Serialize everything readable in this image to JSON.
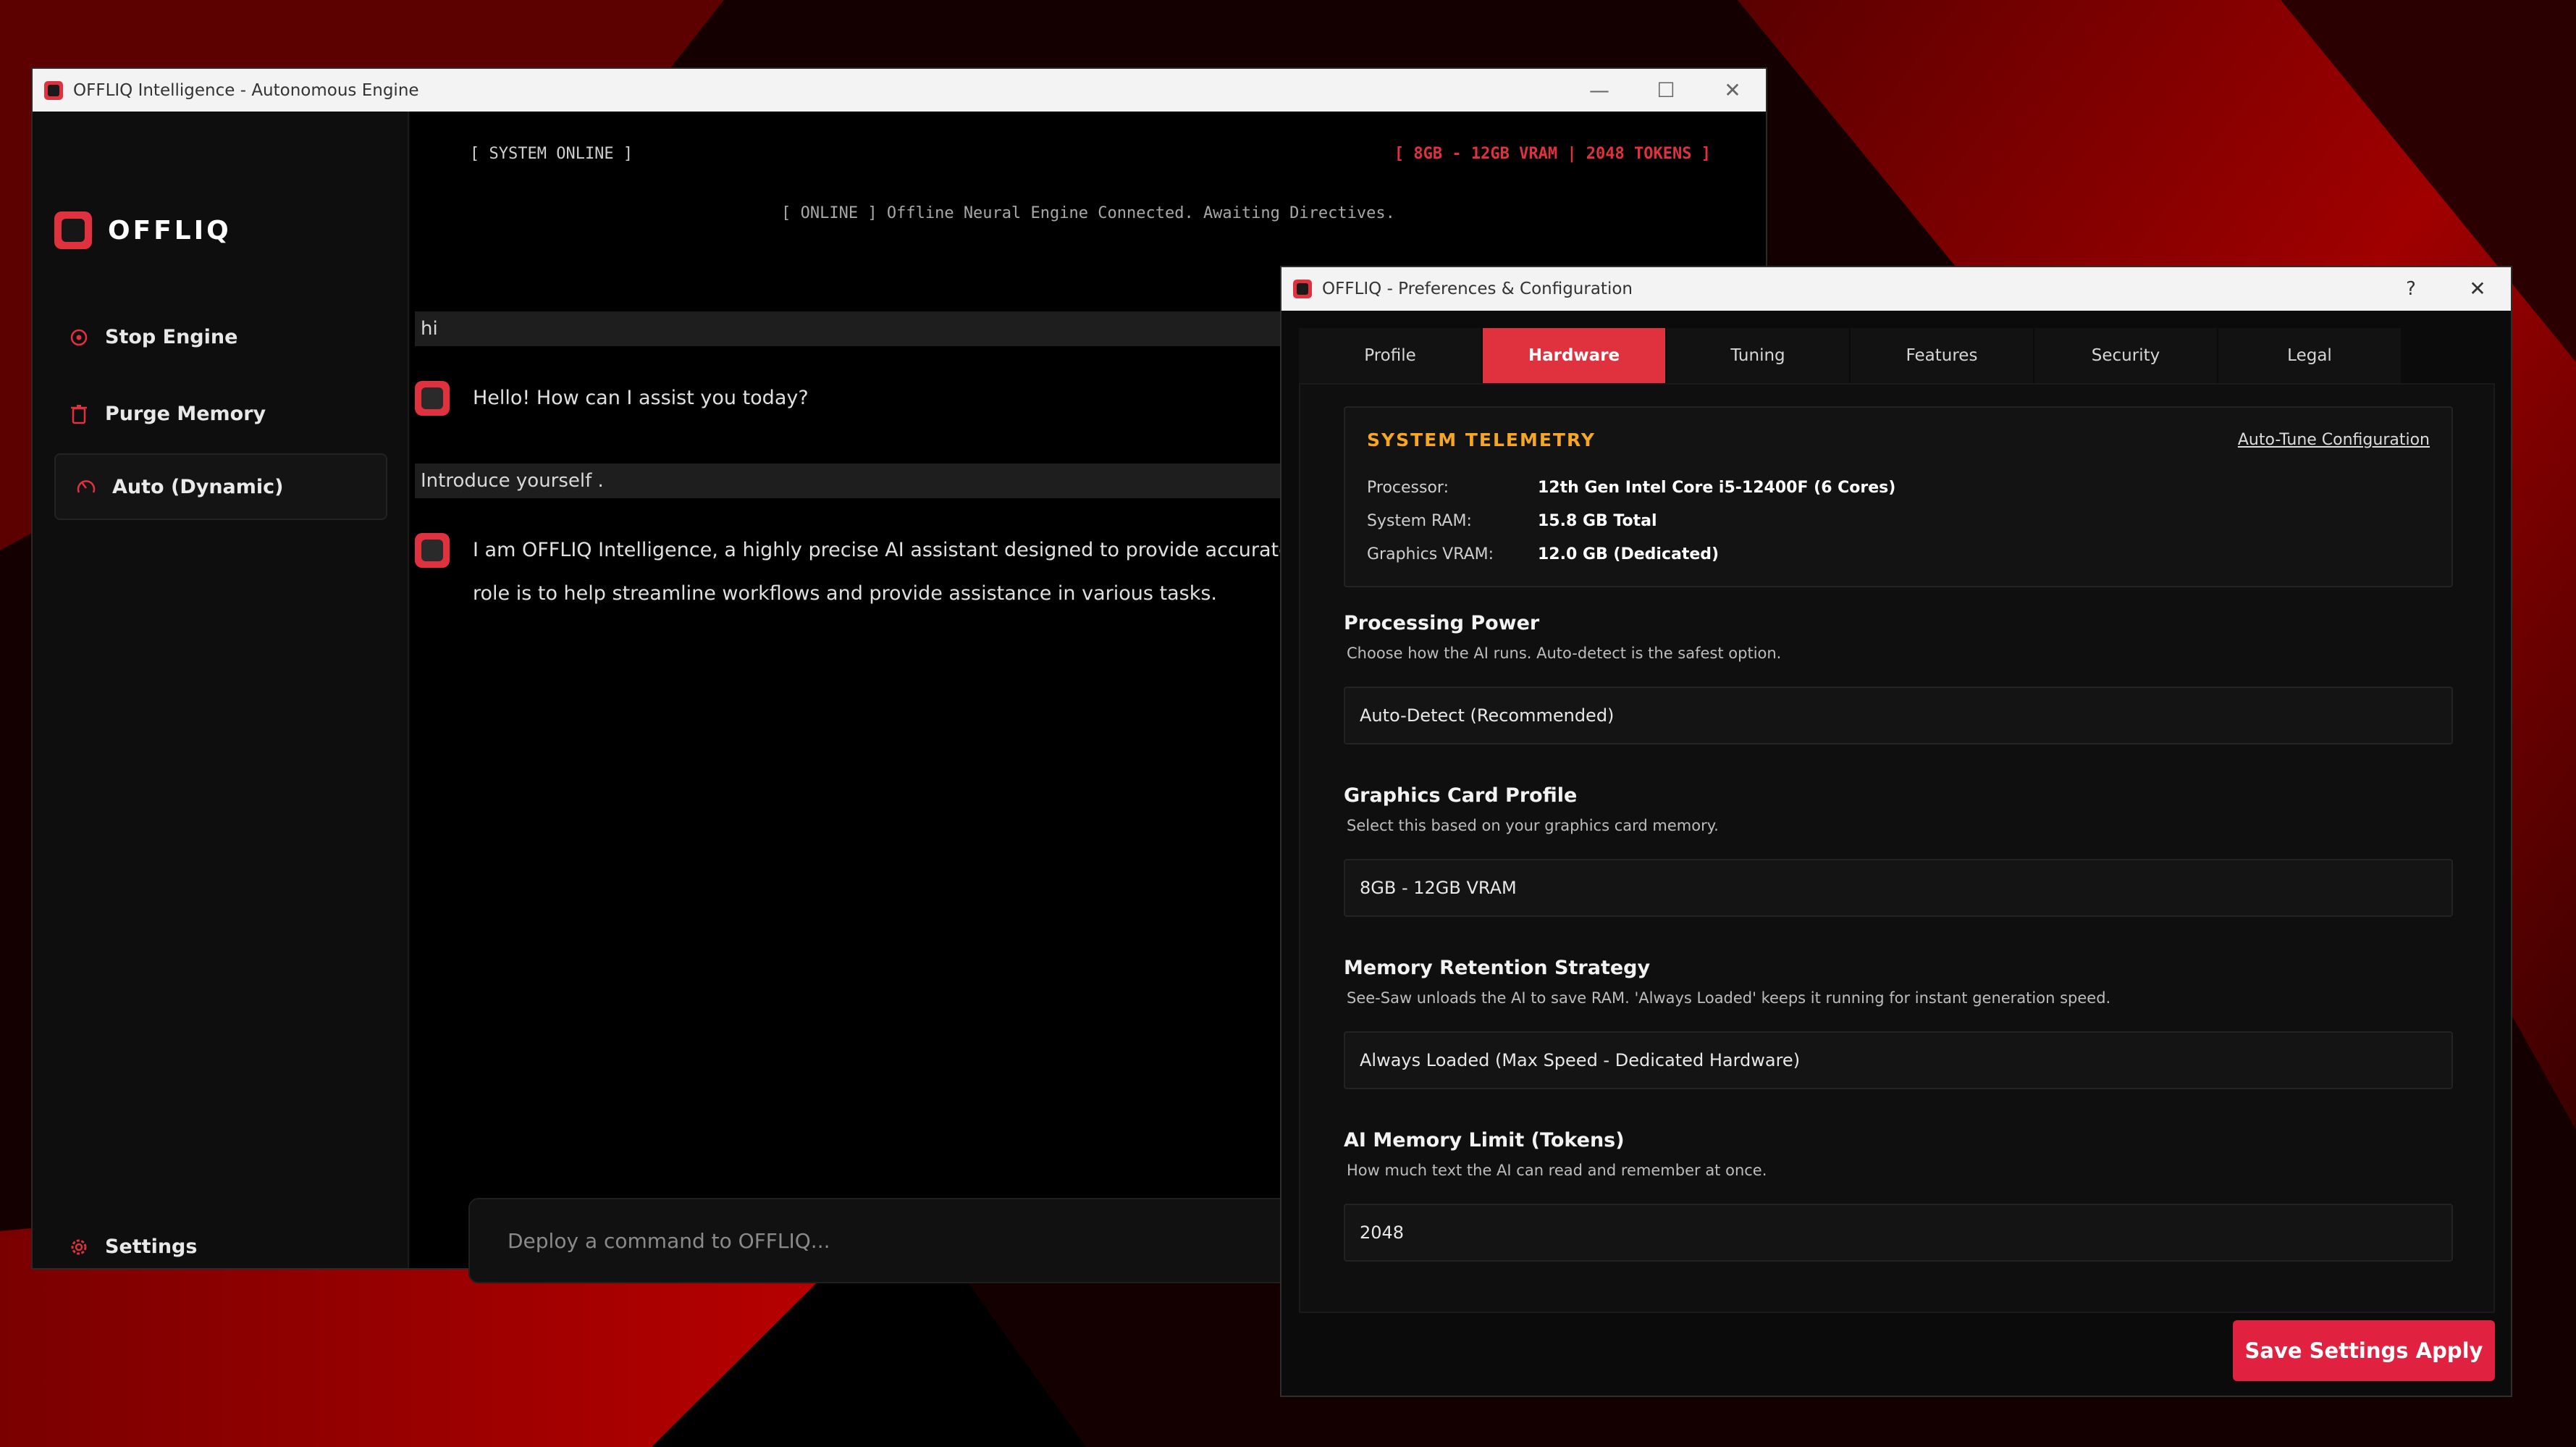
{
  "main_window": {
    "title": "OFFLIQ Intelligence - Autonomous Engine",
    "controls": {
      "minimize": "—",
      "maximize": "☐",
      "close": "✕"
    }
  },
  "sidebar": {
    "logo_text": "OFFLIQ",
    "stop_engine": "Stop Engine",
    "purge_memory": "Purge Memory",
    "mode": "Auto (Dynamic)",
    "settings": "Settings"
  },
  "chat": {
    "status_left": "[ SYSTEM ONLINE ]",
    "status_right": "[ 8GB - 12GB VRAM | 2048 TOKENS ]",
    "status_center": "[ ONLINE ] Offline Neural Engine Connected. Awaiting Directives.",
    "messages": [
      {
        "role": "user",
        "text": "hi"
      },
      {
        "role": "assistant",
        "text": "Hello! How can I assist you today?"
      },
      {
        "role": "user",
        "text": "Introduce yourself ."
      },
      {
        "role": "assistant",
        "line1": "I am OFFLIQ Intelligence, a highly precise AI assistant designed to provide accurate and rele",
        "line2": "role is to help streamline workflows and provide assistance in various tasks."
      }
    ],
    "input_placeholder": "Deploy a command to OFFLIQ..."
  },
  "preferences": {
    "title": "OFFLIQ - Preferences & Configuration",
    "help": "?",
    "close": "✕",
    "tabs": [
      "Profile",
      "Hardware",
      "Tuning",
      "Features",
      "Security",
      "Legal"
    ],
    "active_tab": "Hardware",
    "telemetry": {
      "title": "SYSTEM TELEMETRY",
      "link": "Auto-Tune Configuration",
      "processor_label": "Processor:",
      "processor_value": "12th Gen Intel Core i5-12400F (6 Cores)",
      "ram_label": "System RAM:",
      "ram_value": "15.8 GB Total",
      "vram_label": "Graphics VRAM:",
      "vram_value": "12.0 GB (Dedicated)"
    },
    "processing_power": {
      "title": "Processing Power",
      "desc": "Choose how the AI runs. Auto-detect is the safest option.",
      "value": "Auto-Detect (Recommended)"
    },
    "gpu_profile": {
      "title": "Graphics Card Profile",
      "desc": "Select this based on your graphics card memory.",
      "value": "8GB - 12GB VRAM"
    },
    "memory_strategy": {
      "title": "Memory Retention Strategy",
      "desc": "See-Saw unloads the AI to save RAM. 'Always Loaded' keeps it running for instant generation speed.",
      "value": "Always Loaded (Max Speed - Dedicated Hardware)"
    },
    "token_limit": {
      "title": "AI Memory Limit (Tokens)",
      "desc": "How much text the AI can read and remember at once.",
      "value": "2048"
    },
    "save_button": "Save Settings  Apply"
  },
  "colors": {
    "accent": "#e0313f",
    "telemetry_title": "#f5a623"
  }
}
